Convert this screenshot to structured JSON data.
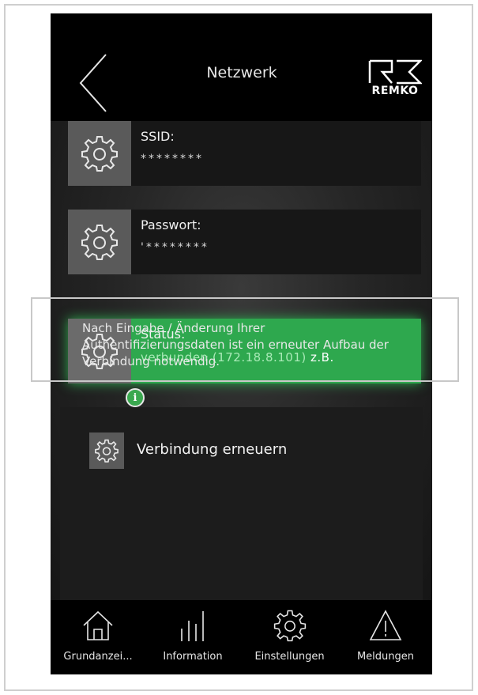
{
  "header": {
    "title": "Netzwerk",
    "logo_text": "REMKO"
  },
  "settings": [
    {
      "label": "SSID:",
      "value": "********"
    },
    {
      "label": "Passwort:",
      "value": "'********"
    }
  ],
  "status": {
    "label": "Status:",
    "value": "verbunden (172.18.8.101)",
    "example": "z.B."
  },
  "info": {
    "text": "Nach Eingabe / Änderung Ihrer Authentifizierungsdaten ist ein erneuter Aufbau der Verbindung notwendig.",
    "icon_glyph": "i"
  },
  "renew_button": {
    "label": "Verbindung erneuern"
  },
  "nav": [
    {
      "label": "Grundanzei...",
      "icon": "home-icon"
    },
    {
      "label": "Information",
      "icon": "bars-icon"
    },
    {
      "label": "Einstellungen",
      "icon": "gear-icon"
    },
    {
      "label": "Meldungen",
      "icon": "warning-icon"
    }
  ],
  "colors": {
    "status_green": "#2ea84e",
    "background": "#000000",
    "gear_box": "#5a5a5a"
  }
}
